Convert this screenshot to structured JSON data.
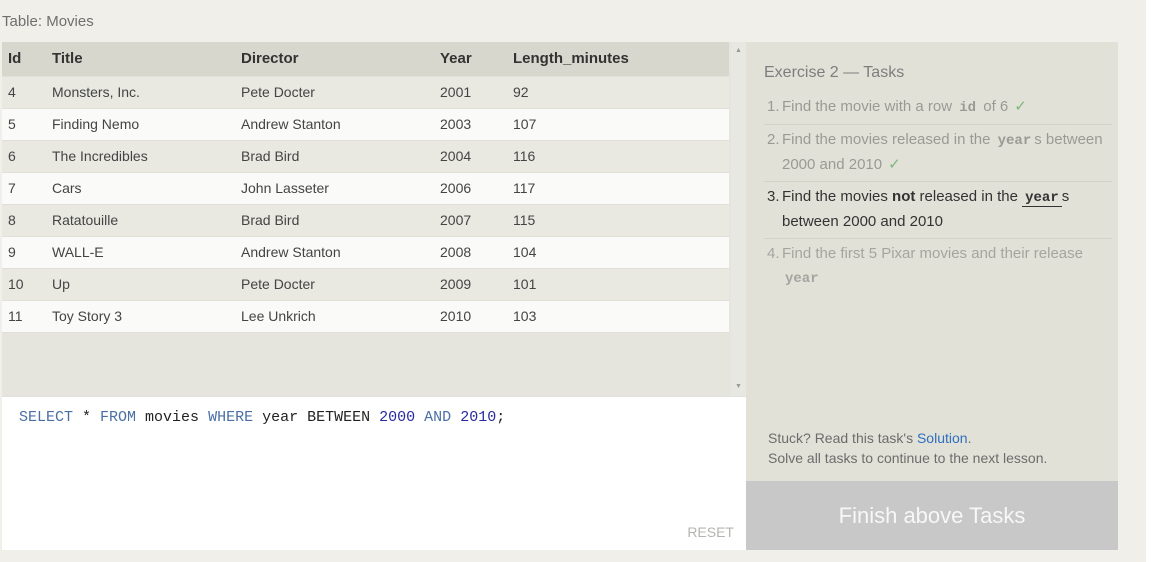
{
  "table_label": "Table: Movies",
  "columns": [
    "Id",
    "Title",
    "Director",
    "Year",
    "Length_minutes"
  ],
  "rows": [
    {
      "id": "4",
      "title": "Monsters, Inc.",
      "director": "Pete Docter",
      "year": "2001",
      "length": "92"
    },
    {
      "id": "5",
      "title": "Finding Nemo",
      "director": "Andrew Stanton",
      "year": "2003",
      "length": "107"
    },
    {
      "id": "6",
      "title": "The Incredibles",
      "director": "Brad Bird",
      "year": "2004",
      "length": "116"
    },
    {
      "id": "7",
      "title": "Cars",
      "director": "John Lasseter",
      "year": "2006",
      "length": "117"
    },
    {
      "id": "8",
      "title": "Ratatouille",
      "director": "Brad Bird",
      "year": "2007",
      "length": "115"
    },
    {
      "id": "9",
      "title": "WALL-E",
      "director": "Andrew Stanton",
      "year": "2008",
      "length": "104"
    },
    {
      "id": "10",
      "title": "Up",
      "director": "Pete Docter",
      "year": "2009",
      "length": "101"
    },
    {
      "id": "11",
      "title": "Toy Story 3",
      "director": "Lee Unkrich",
      "year": "2010",
      "length": "103"
    }
  ],
  "scrollbar": {
    "up_icon": "triangle-up-icon",
    "down_icon": "triangle-down-icon"
  },
  "editor": {
    "tokens": [
      {
        "t": "SELECT",
        "k": "kw"
      },
      {
        "t": " * ",
        "k": ""
      },
      {
        "t": "FROM",
        "k": "kw"
      },
      {
        "t": " movies ",
        "k": ""
      },
      {
        "t": "WHERE",
        "k": "kw"
      },
      {
        "t": " year ",
        "k": ""
      },
      {
        "t": "BETWEEN",
        "k": ""
      },
      {
        "t": " ",
        "k": ""
      },
      {
        "t": "2000",
        "k": "num"
      },
      {
        "t": " ",
        "k": ""
      },
      {
        "t": "AND",
        "k": "kw"
      },
      {
        "t": " ",
        "k": ""
      },
      {
        "t": "2010",
        "k": "num"
      },
      {
        "t": ";",
        "k": ""
      }
    ],
    "reset_label": "RESET"
  },
  "exercise": {
    "title": "Exercise 2 — Tasks",
    "tasks": [
      {
        "num": "1.",
        "parts": [
          "Find the movie with a row ",
          "id",
          " of 6"
        ],
        "state": "done",
        "check": "✓"
      },
      {
        "num": "2.",
        "parts": [
          "Find the movies released in the ",
          "year",
          "s between 2000 and 2010"
        ],
        "state": "done",
        "check": "✓"
      },
      {
        "num": "3.",
        "parts": [
          "Find the movies ",
          "not",
          " released in the ",
          "year",
          "s between 2000 and 2010"
        ],
        "state": "current",
        "check": ""
      },
      {
        "num": "4.",
        "parts": [
          "Find the first 5 Pixar movies and their release ",
          "year"
        ],
        "state": "future",
        "check": ""
      }
    ],
    "stuck_prefix": "Stuck? Read this task's ",
    "stuck_link": "Solution",
    "stuck_suffix": ".",
    "continue_text": "Solve all tasks to continue to the next lesson.",
    "finish_label": "Finish above Tasks"
  },
  "colors": {
    "accent_link": "#2e6fbf",
    "check": "#7cb77c",
    "keyword": "#4a6fa5",
    "number": "#2a2aa0"
  }
}
